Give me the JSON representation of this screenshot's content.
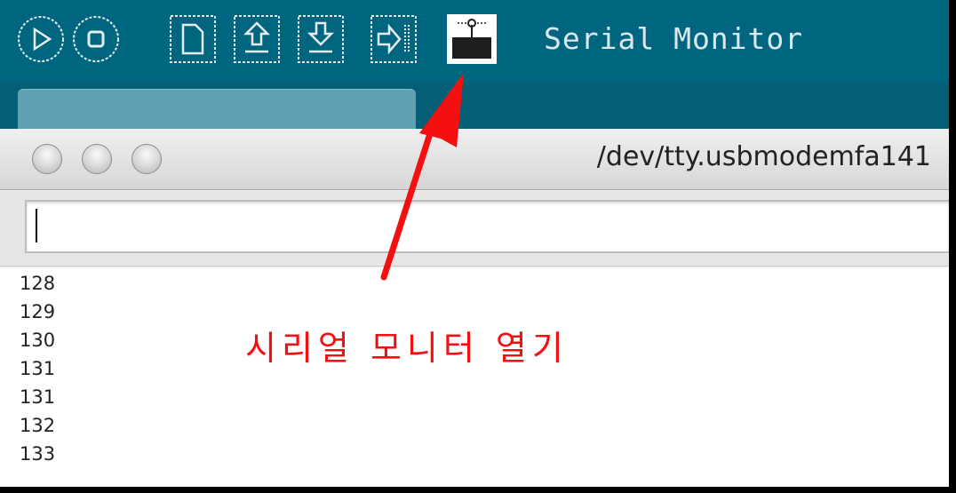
{
  "toolbar": {
    "buttons": [
      {
        "icon": "verify-play-icon"
      },
      {
        "icon": "stop-icon"
      },
      {
        "icon": "new-file-icon"
      },
      {
        "icon": "open-upload-arrow-icon"
      },
      {
        "icon": "save-download-arrow-icon"
      },
      {
        "icon": "export-upload-icon"
      },
      {
        "icon": "serial-monitor-icon"
      }
    ],
    "hover_label": "Serial Monitor",
    "background_color": "#006680"
  },
  "serial_window": {
    "title": "/dev/tty.usbmodemfa141",
    "input_value": ""
  },
  "output_lines": [
    "128",
    "129",
    "130",
    "131",
    "131",
    "132",
    "133"
  ],
  "annotation": {
    "text": "시리얼 모니터 열기",
    "color": "#f41010"
  }
}
